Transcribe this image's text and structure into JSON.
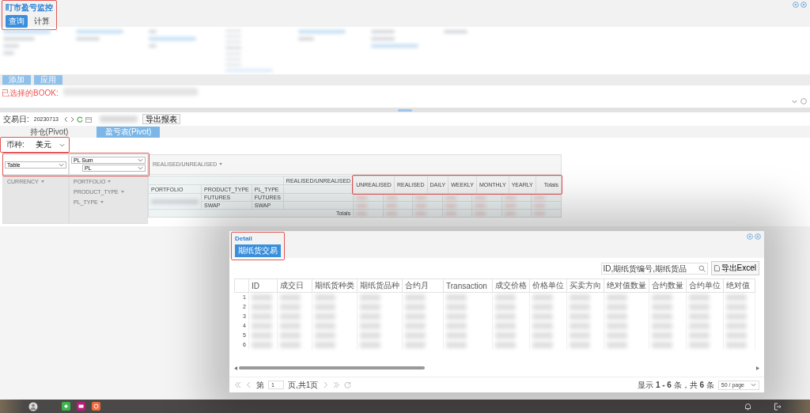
{
  "page": {
    "title": "盯市盈亏监控",
    "tabs": [
      {
        "label": "查询",
        "selected": true
      },
      {
        "label": "计算",
        "selected": false
      }
    ]
  },
  "filter_actions": [
    "添加",
    "应用"
  ],
  "book": {
    "label": "已选择的BOOK:"
  },
  "toolbar": {
    "date_label": "交易日:",
    "date_value": "20230713",
    "export_button": "导出报表"
  },
  "view_tabs": [
    {
      "label": "持仓(Pivot)",
      "selected": false
    },
    {
      "label": "盈亏表(Pivot)",
      "selected": true
    }
  ],
  "currency": {
    "label": "币种:",
    "value": "美元"
  },
  "pivot": {
    "renderer": "Table",
    "aggregator": "PL Sum",
    "aggregator_field": "PL",
    "column_fields": [
      "REALISED/UNREALISED"
    ],
    "unused_fields": [
      "CURRENCY"
    ],
    "row_fields": [
      "PORTFOLIO",
      "PRODUCT_TYPE",
      "PL_TYPE"
    ],
    "table": {
      "column_axis": "REALISED/UNREALISED",
      "row_headers": [
        "PORTFOLIO",
        "PRODUCT_TYPE",
        "PL_TYPE"
      ],
      "columns": [
        "UNREALISED",
        "REALISED",
        "DAILY",
        "WEEKLY",
        "MONTHLY",
        "YEARLY",
        "Totals"
      ],
      "rows": [
        {
          "product_type": "FUTURES",
          "pl_type": "FUTURES"
        },
        {
          "product_type": "SWAP",
          "pl_type": "SWAP"
        }
      ],
      "totals_label": "Totals"
    }
  },
  "detail": {
    "title": "Detail",
    "tab_button": "期纸货交易",
    "search": {
      "placeholder": "ID,期纸货编号,期纸货品"
    },
    "export_button": "导出Excel",
    "columns": [
      "ID",
      "成交日",
      "期纸货种类",
      "期纸货品种",
      "合约月",
      "Transaction",
      "成交价格",
      "价格单位",
      "买卖方向",
      "绝对值数量",
      "合约数量",
      "合约单位",
      "绝对值"
    ],
    "row_numbers": [
      "1",
      "2",
      "3",
      "4",
      "5",
      "6"
    ],
    "pager": {
      "page_label": "第",
      "page_value": "1",
      "page_total": "页,共1页",
      "summary": "显示 **1 - 6** 条，共 **6** 条",
      "page_size": "50 / page"
    }
  }
}
